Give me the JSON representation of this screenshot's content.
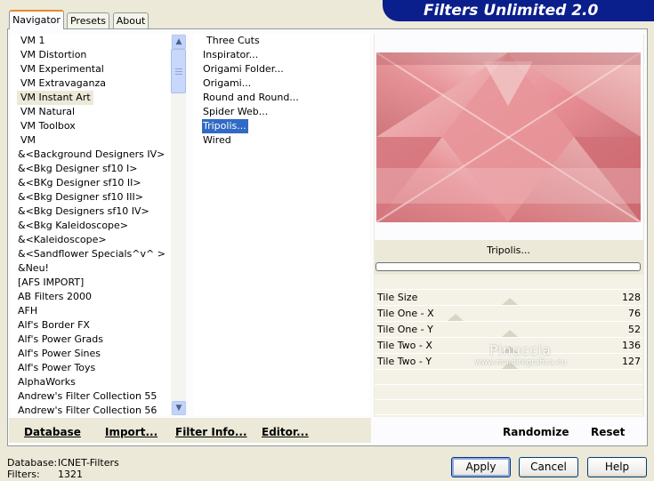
{
  "app": {
    "title": "Filters Unlimited 2.0"
  },
  "tabs": [
    {
      "label": "Navigator",
      "active": true
    },
    {
      "label": "Presets",
      "active": false
    },
    {
      "label": "About",
      "active": false
    }
  ],
  "categories": [
    "VM 1",
    "VM Distortion",
    "VM Experimental",
    "VM Extravaganza",
    "VM Instant Art",
    "VM Natural",
    "VM Toolbox",
    "VM",
    "&<Background Designers IV>",
    "&<Bkg Designer sf10 I>",
    "&<BKg Designer sf10 II>",
    "&<Bkg Designer sf10 III>",
    "&<Bkg Designers sf10 IV>",
    "&<Bkg Kaleidoscope>",
    "&<Kaleidoscope>",
    "&<Sandflower Specials^v^ >",
    "&Neu!",
    "[AFS IMPORT]",
    "AB Filters 2000",
    "AFH",
    "Alf's Border FX",
    "Alf's Power Grads",
    "Alf's Power Sines",
    "Alf's Power Toys",
    "AlphaWorks",
    "Andrew's Filter Collection 55",
    "Andrew's Filter Collection 56"
  ],
  "selected_category": "VM Instant Art",
  "filters": [
    "Three Cuts",
    "Inspirator...",
    "Origami Folder...",
    "Origami...",
    "Round and Round...",
    "Spider Web...",
    "Tripolis...",
    "Wired"
  ],
  "selected_filter": "Tripolis...",
  "preview_caption": "Tripolis...",
  "parameters": [
    {
      "label": "Tile Size",
      "value": "128"
    },
    {
      "label": "Tile One - X",
      "value": "76"
    },
    {
      "label": "Tile One - Y",
      "value": "52"
    },
    {
      "label": "Tile Two - X",
      "value": "136"
    },
    {
      "label": "Tile Two - Y",
      "value": "127"
    }
  ],
  "watermark": {
    "line1": "Pinuccia",
    "line2": "www.maidiregrafica.eu"
  },
  "toolbar": {
    "database": "Database",
    "import": "Import...",
    "filter_info": "Filter Info...",
    "editor": "Editor...",
    "randomize": "Randomize",
    "reset": "Reset"
  },
  "status": {
    "database_label": "Database:",
    "database_value": "ICNET-Filters",
    "filters_label": "Filters:",
    "filters_value": "1321"
  },
  "buttons": {
    "apply": "Apply",
    "cancel": "Cancel",
    "help": "Help"
  },
  "colors": {
    "banner": "#0A1E8C",
    "selection": "#316AC5",
    "dialog_bg": "#ECE9D8"
  }
}
